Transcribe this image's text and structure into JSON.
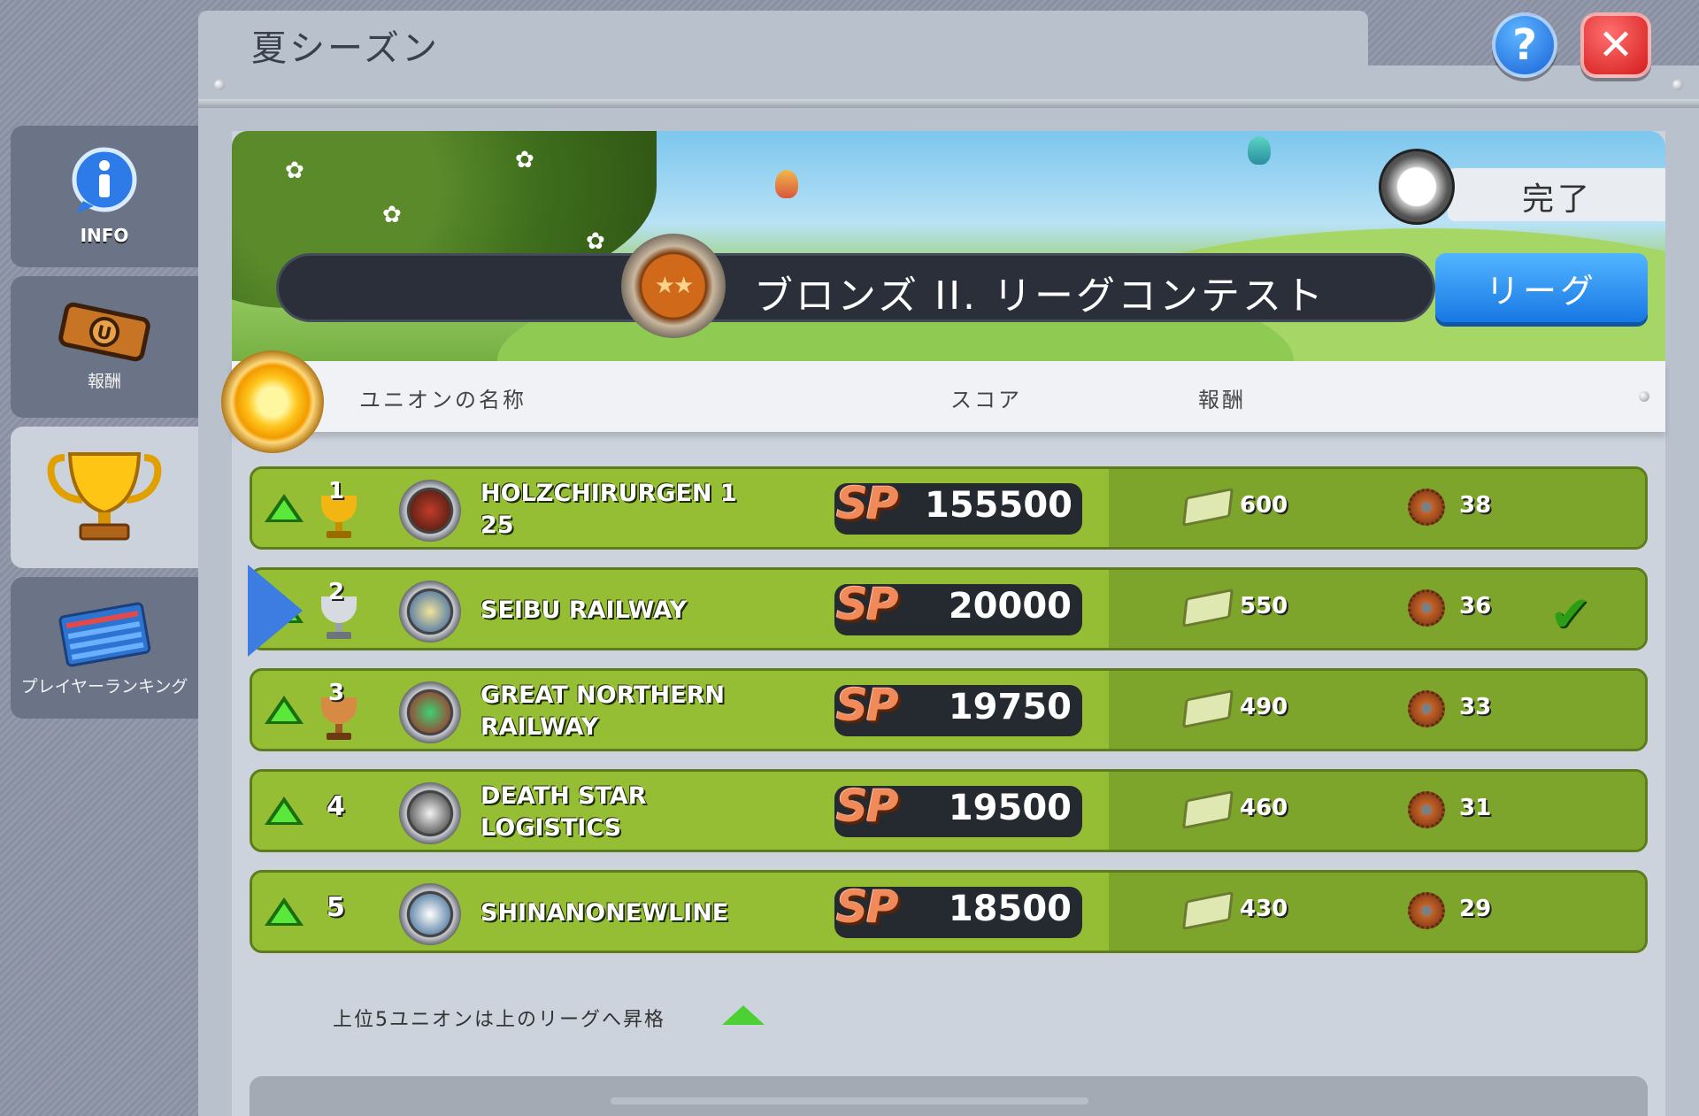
{
  "sidebar": {
    "items": [
      {
        "label": "INFO",
        "icon": "info-icon"
      },
      {
        "label": "報酬",
        "icon": "ticket-icon"
      },
      {
        "label": "",
        "icon": "trophy-icon"
      },
      {
        "label": "プレイヤーランキング",
        "icon": "ranking-board-icon"
      }
    ]
  },
  "panel": {
    "title": "夏シーズン"
  },
  "header_buttons": {
    "help": "?",
    "close": "✕"
  },
  "banner": {
    "timer_label": "完了",
    "league_title": "ブロンズ II. リーグコンテスト",
    "league_medal_stars": "★★",
    "league_button": "リーグ"
  },
  "columns": {
    "name": "ユニオンの名称",
    "score": "スコア",
    "reward": "報酬"
  },
  "rows": [
    {
      "rank": "1",
      "name_line1": "HOLZCHIRURGEN 1",
      "name_line2": "25",
      "score": "155500",
      "cash": "600",
      "gears": "38",
      "trophy": "gold"
    },
    {
      "rank": "2",
      "name_line1": "SEIBU RAILWAY",
      "name_line2": "",
      "score": "20000",
      "cash": "550",
      "gears": "36",
      "trophy": "silver",
      "own_union": true
    },
    {
      "rank": "3",
      "name_line1": "GREAT NORTHERN",
      "name_line2": "RAILWAY",
      "score": "19750",
      "cash": "490",
      "gears": "33",
      "trophy": "bronze"
    },
    {
      "rank": "4",
      "name_line1": "DEATH STAR",
      "name_line2": "LOGISTICS",
      "score": "19500",
      "cash": "460",
      "gears": "31"
    },
    {
      "rank": "5",
      "name_line1": "SHINANONEWLINE",
      "name_line2": "",
      "score": "18500",
      "cash": "430",
      "gears": "29"
    }
  ],
  "score_prefix": "SP",
  "promotion_text": "上位5ユニオンは上のリーグへ昇格",
  "colors": {
    "row_green": "#95be35",
    "row_green_dark": "#7ea52b",
    "league_blue": "#1878e4",
    "close_red": "#d41b1b"
  }
}
